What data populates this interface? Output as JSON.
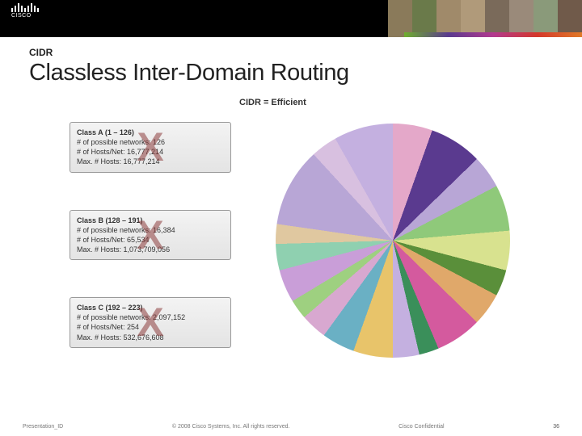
{
  "header": {
    "logo_text": "CISCO"
  },
  "topic": "CIDR",
  "title": "Classless Inter-Domain Routing",
  "cidr_eq": "CIDR = Efficient",
  "cards": [
    {
      "title": "Class A (1 – 126)",
      "l1": "# of possible networks: 126",
      "l2": "# of Hosts/Net: 16,777,214",
      "l3": "Max. # Hosts: 16,777,214"
    },
    {
      "title": "Class B (128 – 191)",
      "l1": "# of possible networks: 16,384",
      "l2": "# of Hosts/Net: 65,534",
      "l3": "Max. # Hosts: 1,073,709,056"
    },
    {
      "title": "Class C (192 – 223)",
      "l1": "# of possible networks: 2,097,152",
      "l2": "# of Hosts/Net: 254",
      "l3": "Max. # Hosts: 532,676,608"
    }
  ],
  "x_mark": "X",
  "footer": {
    "left": "Presentation_ID",
    "center": "© 2008 Cisco Systems, Inc. All rights reserved.",
    "right": "Cisco Confidential",
    "page": "36"
  },
  "chart_data": {
    "type": "pie",
    "title": "",
    "slices": [
      {
        "value": 6,
        "color": "#e4a8c9"
      },
      {
        "value": 8,
        "color": "#5a3a8f"
      },
      {
        "value": 5,
        "color": "#b8a6d6"
      },
      {
        "value": 7,
        "color": "#8fc97a"
      },
      {
        "value": 6,
        "color": "#d8e28f"
      },
      {
        "value": 4,
        "color": "#5a8f3a"
      },
      {
        "value": 5,
        "color": "#e0a86a"
      },
      {
        "value": 7,
        "color": "#d45a9e"
      },
      {
        "value": 3,
        "color": "#3a8f5a"
      },
      {
        "value": 4,
        "color": "#c4b0e0"
      },
      {
        "value": 6,
        "color": "#e8c46a"
      },
      {
        "value": 5,
        "color": "#6ab0c4"
      },
      {
        "value": 4,
        "color": "#d8a8d0"
      },
      {
        "value": 3,
        "color": "#9ed080"
      },
      {
        "value": 5,
        "color": "#c99ed8"
      },
      {
        "value": 4,
        "color": "#8fd0b0"
      },
      {
        "value": 3,
        "color": "#e0c8a0"
      },
      {
        "value": 12,
        "color": "#b8a6d6"
      },
      {
        "value": 4,
        "color": "#d8c0e0"
      },
      {
        "value": 9,
        "color": "#c4b0e0"
      }
    ]
  }
}
